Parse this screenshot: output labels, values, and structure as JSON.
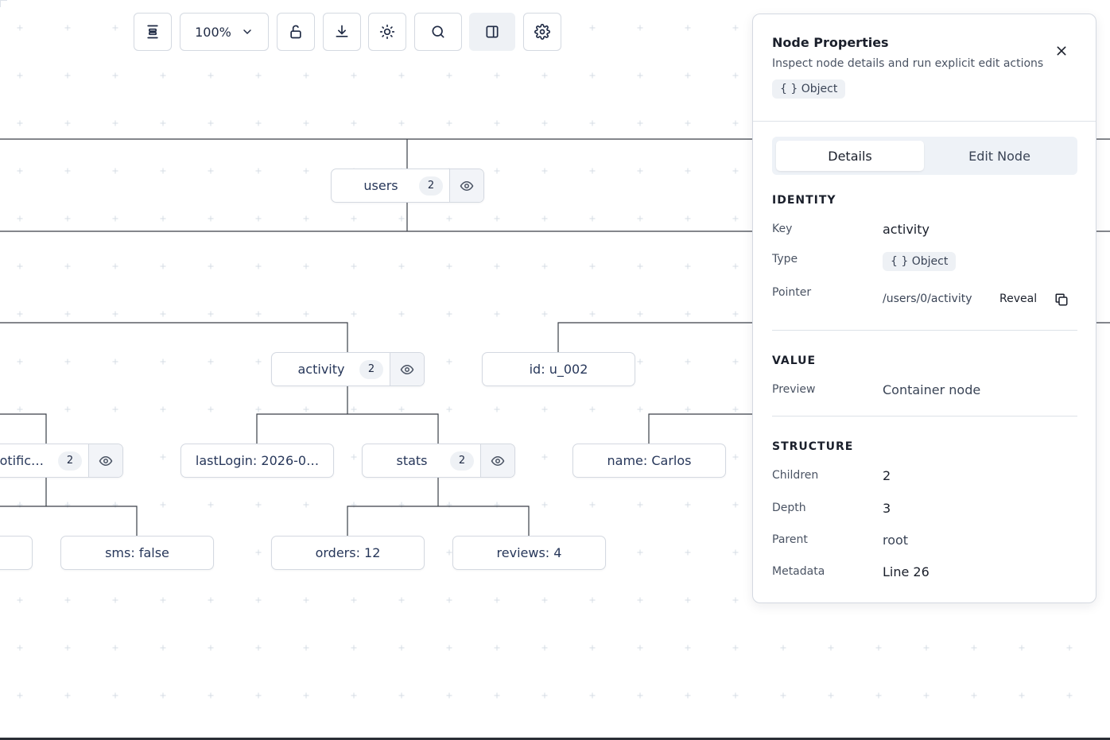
{
  "toolbar": {
    "zoom_label": "100%",
    "icons": [
      "align-center-icon",
      "chevron-down-icon",
      "unlock-icon",
      "download-icon",
      "sun-icon",
      "search-icon",
      "panel-toggle-icon",
      "gear-icon"
    ]
  },
  "graph": {
    "nodes": {
      "users": {
        "label": "users",
        "count": "2"
      },
      "activity": {
        "label": "activity",
        "count": "2"
      },
      "id": {
        "label": "id: u_002"
      },
      "notifications": {
        "label": "otific…",
        "count": "2"
      },
      "lastLogin": {
        "label": "lastLogin: 2026-0…"
      },
      "stats": {
        "label": "stats",
        "count": "2"
      },
      "name": {
        "label": "name: Carlos"
      },
      "sms": {
        "label": "sms: false"
      },
      "orders": {
        "label": "orders: 12"
      },
      "reviews": {
        "label": "reviews: 4"
      }
    }
  },
  "panel": {
    "title": "Node Properties",
    "subtitle": "Inspect node details and run explicit edit actions",
    "type_badge": "{ } Object",
    "tabs": {
      "details": "Details",
      "edit": "Edit Node"
    },
    "identity": {
      "heading": "IDENTITY",
      "key_label": "Key",
      "key_value": "activity",
      "type_label": "Type",
      "type_value": "{ } Object",
      "pointer_label": "Pointer",
      "pointer_value": "/users/0/activity",
      "reveal_label": "Reveal"
    },
    "value": {
      "heading": "VALUE",
      "preview_label": "Preview",
      "preview_value": "Container node"
    },
    "structure": {
      "heading": "STRUCTURE",
      "children_label": "Children",
      "children_value": "2",
      "depth_label": "Depth",
      "depth_value": "3",
      "parent_label": "Parent",
      "parent_value": "root",
      "metadata_label": "Metadata",
      "metadata_value": "Line 26"
    }
  },
  "colors": {
    "node_text": "#27375a",
    "edge": "#3a3f48",
    "border": "#d4d9e1",
    "grid": "#dde3ea"
  }
}
